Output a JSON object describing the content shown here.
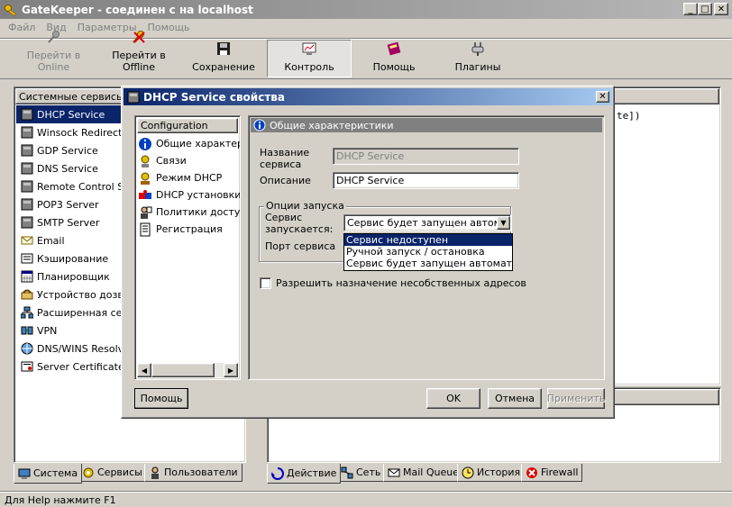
{
  "app": {
    "title": "GateKeeper - соединен с на localhost"
  },
  "menu": [
    "Файл",
    "Вид",
    "Параметры",
    "Помощь"
  ],
  "toolbar": [
    {
      "label": "Перейти в Online",
      "icon": "key-icon",
      "disabled": true
    },
    {
      "label": "Перейти в Offline",
      "icon": "key-offline-icon"
    },
    {
      "label": "Сохранение",
      "icon": "floppy-disk-icon"
    },
    {
      "label": "Контроль",
      "icon": "monitor-chart-icon",
      "pressed": true
    },
    {
      "label": "Помощь",
      "icon": "help-book-icon"
    },
    {
      "label": "Плагины",
      "icon": "plug-icon"
    }
  ],
  "left_panel": {
    "header": "Системные сервисы",
    "items": [
      {
        "label": "DHCP Service",
        "icon": "server-icon",
        "selected": true
      },
      {
        "label": "Winsock Redirector",
        "icon": "server-icon"
      },
      {
        "label": "GDP Service",
        "icon": "server-icon"
      },
      {
        "label": "DNS Service",
        "icon": "server-icon"
      },
      {
        "label": "Remote Control Service",
        "icon": "server-icon"
      },
      {
        "label": "POP3 Server",
        "icon": "server-icon"
      },
      {
        "label": "SMTP Server",
        "icon": "server-icon"
      },
      {
        "label": "Email",
        "icon": "envelope-icon"
      },
      {
        "label": "Кэширование",
        "icon": "cache-icon"
      },
      {
        "label": "Планировщик",
        "icon": "calendar-icon"
      },
      {
        "label": "Устройство дозвона",
        "icon": "dialer-icon"
      },
      {
        "label": "Расширенная сеть",
        "icon": "network-icon"
      },
      {
        "label": "VPN",
        "icon": "vpn-icon"
      },
      {
        "label": "DNS/WINS Resolver",
        "icon": "resolver-icon"
      },
      {
        "label": "Server Certificates",
        "icon": "certificate-icon"
      }
    ],
    "tabs": [
      "Система",
      "Сервисы",
      "Пользователи"
    ]
  },
  "right_panel": {
    "text_fragment": "te])",
    "tabs": [
      "Действие",
      "Сеть",
      "Mail Queue",
      "История",
      "Firewall"
    ]
  },
  "status_bar": "Для Help нажмите F1",
  "dialog": {
    "title": "DHCP Service свойства",
    "nav_header": "Configuration",
    "nav_items": [
      {
        "label": "Общие характеристики",
        "icon": "info-icon"
      },
      {
        "label": "Связи",
        "icon": "links-icon"
      },
      {
        "label": "Режим DHCP",
        "icon": "dhcp-mode-icon"
      },
      {
        "label": "DHCP установки",
        "icon": "puzzle-icon"
      },
      {
        "label": "Политики доступа",
        "icon": "policy-user-icon"
      },
      {
        "label": "Регистрация",
        "icon": "document-icon"
      }
    ],
    "section_title": "Общие характеристики",
    "name_label": "Название сервиса",
    "name_value": "DHCP Service",
    "desc_label": "Описание",
    "desc_value": "DHCP Service",
    "group_label": "Опции запуска",
    "start_label": "Сервис запускается:",
    "start_value": "Сервис будет запущен автомати",
    "start_options": [
      "Сервис недоступен",
      "Ручной запуск / остановка",
      "Сервис будет запущен автоматичес"
    ],
    "port_label": "Порт сервиса",
    "checkbox_label": "Разрешить назначение несобственных адресов",
    "checkbox_checked": false,
    "help_button": "Помощь",
    "ok_button": "OK",
    "cancel_button": "Отмена",
    "apply_button": "Применить"
  }
}
